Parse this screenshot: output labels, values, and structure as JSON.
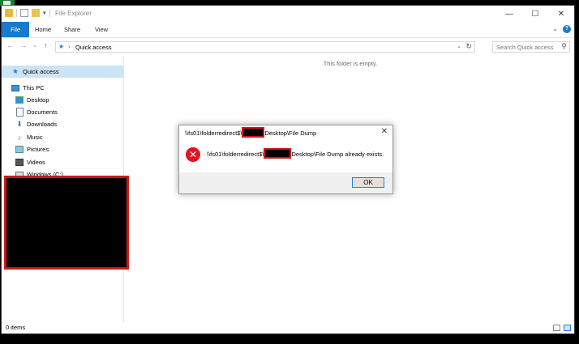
{
  "window": {
    "title": "File Explorer",
    "controls": {
      "minimize": "—",
      "maximize": "☐",
      "close": "✕"
    }
  },
  "ribbon": {
    "tabs": [
      "File",
      "Home",
      "Share",
      "View"
    ],
    "help": "?",
    "expand": "⌄"
  },
  "navigation": {
    "back": "←",
    "forward": "→",
    "recent": "⌄",
    "up": "↑",
    "address_sep": "›",
    "address": "Quick access",
    "address_dropdown": "⌄",
    "refresh": "↻",
    "search_placeholder": "Search Quick access",
    "search_icon": "⚲"
  },
  "sidebar": {
    "items": [
      {
        "label": "Quick access",
        "icon": "star-icon",
        "glyph": "★",
        "color": "#2a7fd4"
      },
      {
        "label": "This PC",
        "icon": "computer-icon",
        "glyph": "🖳",
        "color": "#3a8fd8"
      },
      {
        "label": "Desktop",
        "icon": "desktop-icon",
        "glyph": "▣",
        "color": "#2f8fd8"
      },
      {
        "label": "Documents",
        "icon": "documents-icon",
        "glyph": "▤",
        "color": "#6b7fa0"
      },
      {
        "label": "Downloads",
        "icon": "downloads-icon",
        "glyph": "⬇",
        "color": "#2a7fd4"
      },
      {
        "label": "Music",
        "icon": "music-icon",
        "glyph": "♪",
        "color": "#2a7fd4"
      },
      {
        "label": "Pictures",
        "icon": "pictures-icon",
        "glyph": "▨",
        "color": "#4a9a6a"
      },
      {
        "label": "Videos",
        "icon": "videos-icon",
        "glyph": "▦",
        "color": "#555"
      },
      {
        "label": "Windows (C:)",
        "icon": "drive-icon",
        "glyph": "▭",
        "color": "#555"
      }
    ]
  },
  "main": {
    "empty_text": "This folder is empty."
  },
  "status_bar": {
    "item_count": "0 items"
  },
  "dialog": {
    "title_prefix": "\\\\fs01\\folderredirect$\\",
    "title_suffix": "Desktop\\File Dump",
    "message_prefix": "\\\\fs01\\folderredirect$\\",
    "message_suffix": "Desktop\\File Dump already exists.",
    "ok_label": "OK",
    "close": "✕",
    "error_glyph": "✕"
  },
  "colors": {
    "accent": "#1979ca",
    "selection": "#cce4f7",
    "error": "#e81123",
    "redaction_border": "#d01616"
  }
}
